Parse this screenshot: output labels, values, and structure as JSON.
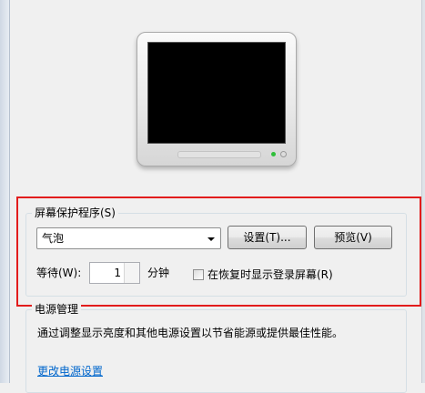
{
  "screensaver": {
    "group_title": "屏幕保护程序(S)",
    "selected_value": "气泡",
    "settings_button": "设置(T)...",
    "preview_button": "预览(V)",
    "wait_label": "等待(W):",
    "wait_value": "1",
    "wait_unit": "分钟",
    "resume_checkbox_label": "在恢复时显示登录屏幕(R)",
    "resume_checked": false
  },
  "power": {
    "group_title": "电源管理",
    "description": "通过调整显示亮度和其他电源设置以节省能源或提供最佳性能。",
    "change_link": "更改电源设置"
  },
  "colors": {
    "highlight_border": "#e21c1c",
    "link": "#0066cc"
  }
}
